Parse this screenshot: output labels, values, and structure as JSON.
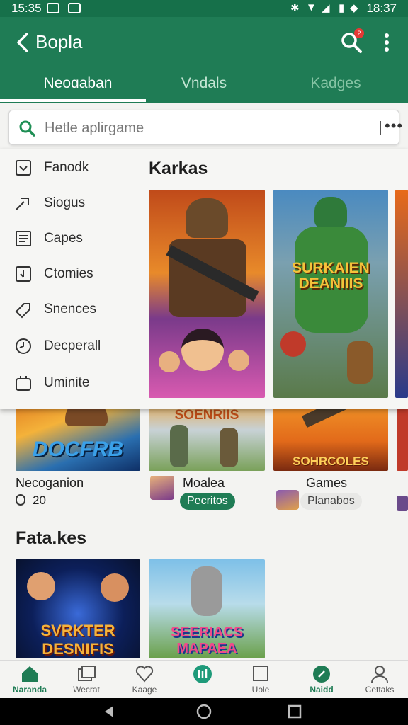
{
  "status_bar": {
    "time_left": "15:35",
    "time_right": "18:37"
  },
  "app_bar": {
    "title": "Bopla",
    "notification_count": "2"
  },
  "tabs": [
    {
      "label": "Neoɑaban",
      "active": true
    },
    {
      "label": "Vndals",
      "active": false
    },
    {
      "label": "Kadges",
      "active": false
    }
  ],
  "search": {
    "placeholder": "Hetle aplirgame",
    "more": "•••"
  },
  "menu": {
    "items": [
      {
        "label": "Fanodk",
        "icon": "checkbox-icon"
      },
      {
        "label": "Siogus",
        "icon": "share-icon"
      },
      {
        "label": "Capes",
        "icon": "document-icon"
      },
      {
        "label": "Ctomies",
        "icon": "download-icon"
      },
      {
        "label": "Snences",
        "icon": "tag-icon"
      },
      {
        "label": "Decperall",
        "icon": "clock-icon"
      },
      {
        "label": "Uminite",
        "icon": "bag-icon"
      }
    ]
  },
  "featured": {
    "title": "Karkas",
    "cards": [
      {
        "name": "soldier-girl-art",
        "text": ""
      },
      {
        "name": "green-warrior-art",
        "text": "SURKAIEN DEANIIIS"
      }
    ]
  },
  "row_items": [
    {
      "card_text": "DOCFRB",
      "title": "Necoganion",
      "meta": "20"
    },
    {
      "card_text": "SOENRIIS",
      "title": "Moalea",
      "chip": "Pecritos"
    },
    {
      "card_text": "SOHRCOLES",
      "title": "Games",
      "chip": "Planabos"
    }
  ],
  "section2": {
    "title": "Fatа.kes",
    "cards": [
      {
        "card_text": "SVRKTER DESNIFIS"
      },
      {
        "card_text": "SEERIACS MAPAEA"
      }
    ]
  },
  "bottom_nav": [
    {
      "label": "Naranda",
      "icon": "home-icon",
      "active": true
    },
    {
      "label": "Wecrat",
      "icon": "gallery-icon",
      "active": false
    },
    {
      "label": "Kaage",
      "icon": "heart-icon",
      "active": false
    },
    {
      "label": "",
      "icon": "equalizer-icon",
      "active": false
    },
    {
      "label": "Uole",
      "icon": "square-icon",
      "active": false
    },
    {
      "label": "Naidd",
      "icon": "leaf-icon",
      "active": true
    },
    {
      "label": "Cettaks",
      "icon": "person-icon",
      "active": false
    }
  ],
  "colors": {
    "primary": "#1f7c55",
    "status_bar": "#16704a",
    "accent_badge": "#e53935"
  }
}
